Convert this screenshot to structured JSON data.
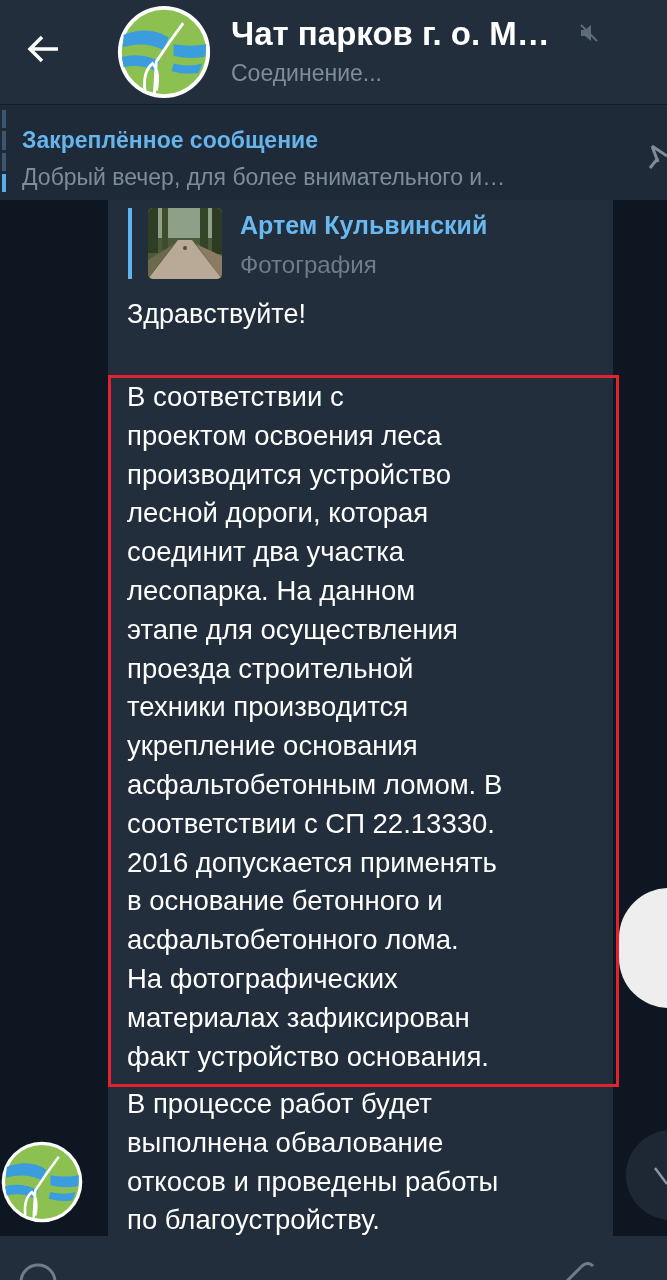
{
  "header": {
    "title": "Чат парков г. о. М…",
    "status": "Соединение...",
    "muted": true
  },
  "pinned": {
    "label": "Закреплённое сообщение",
    "text": "Добрый вечер, для более внимательного и…"
  },
  "message": {
    "reply": {
      "author": "Артем Кульвинский",
      "kind": "Фотография"
    },
    "greeting": "Здравствуйте!",
    "highlighted_lines": [
      "В соответствии с",
      "проектом освоения леса",
      "производится устройство",
      "лесной дороги, которая",
      "соединит два участка",
      "лесопарка. На данном",
      "этапе для осуществления",
      "проезда строительной",
      "техники производится",
      "укрепление основания",
      "асфальтобетонным ломом. В",
      "соответствии с СП 22.13330.",
      "2016 допускается применять",
      "в основание бетонного и",
      "асфальтобетонного лома.",
      "На фотографических",
      "материалах зафиксирован",
      "факт устройство основания."
    ],
    "closing_lines": [
      "В процессе работ будет",
      "выполнена обвалование",
      "откосов и проведены работы",
      "по благоустройству."
    ]
  }
}
